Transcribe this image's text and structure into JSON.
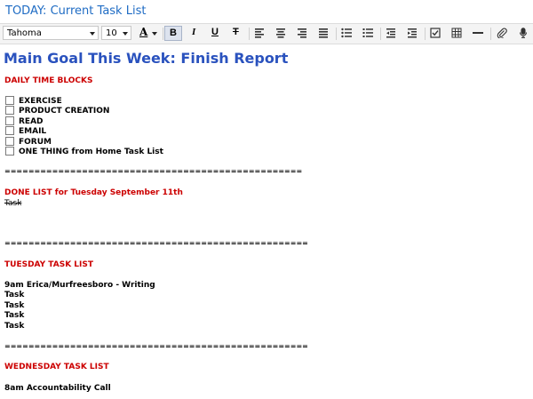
{
  "window": {
    "title": "TODAY: Current Task List"
  },
  "toolbar": {
    "font_family": "Tahoma",
    "font_size": "10",
    "text_color_label": "A",
    "buttons": [
      "bold-icon",
      "italic-icon",
      "underline-icon",
      "strikethrough-icon",
      "align-left-icon",
      "align-center-icon",
      "align-right-icon",
      "align-justify-icon",
      "bulleted-list-icon",
      "numbered-list-icon",
      "outdent-icon",
      "indent-icon",
      "checkbox-icon",
      "table-icon",
      "horizontal-rule-icon",
      "attachment-icon",
      "microphone-icon"
    ],
    "active_button": "bold-icon"
  },
  "note": {
    "main_goal": "Main Goal This Week: Finish Report",
    "time_blocks_heading": "DAILY TIME BLOCKS",
    "time_blocks": [
      {
        "label": "EXERCISE",
        "checked": false
      },
      {
        "label": "PRODUCT CREATION",
        "checked": false
      },
      {
        "label": "READ",
        "checked": false
      },
      {
        "label": "EMAIL",
        "checked": false
      },
      {
        "label": "FORUM",
        "checked": false
      },
      {
        "label": "ONE THING from Home Task List",
        "checked": false
      }
    ],
    "rule_1": "==================================================",
    "done_heading": "DONE LIST for Tuesday September 11th",
    "done_items": [
      "Task"
    ],
    "rule_2": "===================================================",
    "tuesday_heading": "TUESDAY TASK LIST",
    "tuesday_items": [
      "9am Erica/Murfreesboro - Writing",
      "Task",
      "Task",
      "Task",
      "Task"
    ],
    "rule_3": "===================================================",
    "wednesday_heading": "WEDNESDAY TASK LIST",
    "wednesday_items": [
      "8am Accountability Call"
    ]
  },
  "colors": {
    "title": "#1f6cc4",
    "main_goal": "#2a52be",
    "heading": "#cc0000",
    "toolbar_bg": "#f4f4f4"
  }
}
